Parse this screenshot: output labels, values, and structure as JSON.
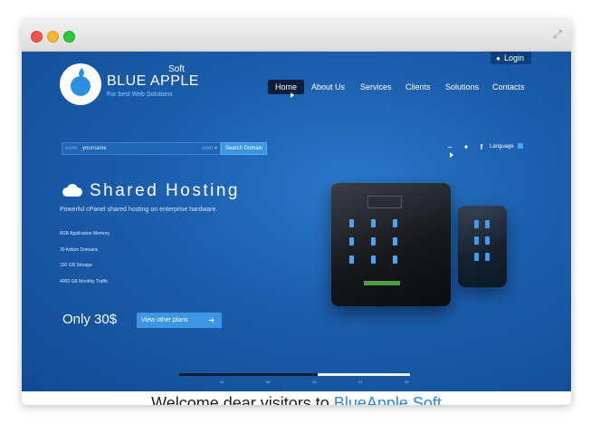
{
  "header": {
    "login_label": "Login",
    "logo_text": "BLUE APPLE",
    "logo_soft": "Soft",
    "logo_tagline": "For best Web Solutions"
  },
  "nav": {
    "items": [
      {
        "label": "Home",
        "active": true
      },
      {
        "label": "About Us",
        "active": false
      },
      {
        "label": "Services",
        "active": false
      },
      {
        "label": "Clients",
        "active": false
      },
      {
        "label": "Solutions",
        "active": false
      },
      {
        "label": "Contacts",
        "active": false
      }
    ]
  },
  "search": {
    "prefix": "www.",
    "value": "yourname",
    "tld": ".com",
    "button_label": "Search Domain"
  },
  "toolbar": {
    "language_label": "Language",
    "icons": [
      "rss-icon",
      "twitter-icon",
      "facebook-icon"
    ]
  },
  "hero": {
    "title": "Shared Hosting",
    "subtitle": "Powerful cPanel shared hosting on enterprise hardware.",
    "features": [
      "8GB Application Memory",
      "30 Addon Domains",
      "100 GB Storage",
      "4000 GB Monthly Traffic"
    ],
    "price": "Only 30$",
    "plans_button": "View other plans"
  },
  "slider": {
    "labels": [
      "01",
      "02",
      "03",
      "04",
      "05"
    ],
    "active_index": 2
  },
  "welcome": {
    "text": "Welcome dear visitors to ",
    "brand": "BlueApple Soft"
  },
  "colors": {
    "site_bg": "#1c5fae",
    "accent": "#3c96e4",
    "brand_blue": "#2b8ad8"
  }
}
